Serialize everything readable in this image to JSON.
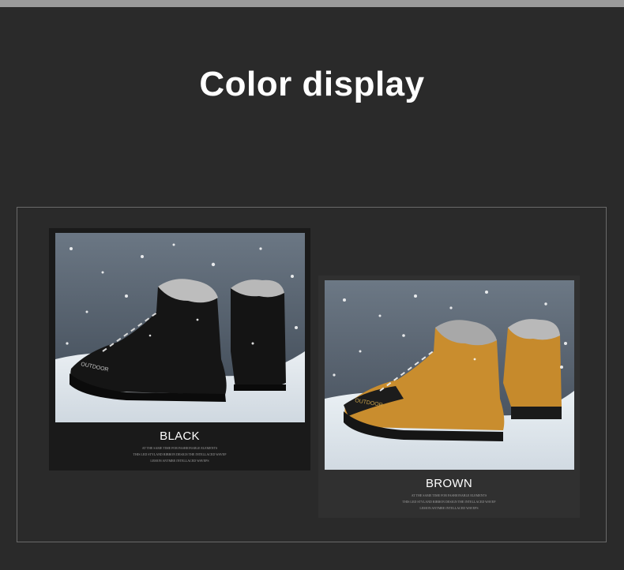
{
  "title": "Color display",
  "colors": {
    "background": "#2a2a2a",
    "black_card": "#1a1a1a",
    "brown_card": "#303030",
    "snow_sky": "#5a6673"
  },
  "variants": [
    {
      "label": "BLACK",
      "boot_color": "#151515",
      "boot_brand": "OUTDOOR",
      "caption_lines": [
        "AT THE SAME TIME FOR FASHIONABLE ELEMENTS",
        "THIS LED STYLAND RIBBON DESIGN THE INTELLACED WAVEP",
        "LEMON ANTMRE INTELLACED WAVEPS"
      ]
    },
    {
      "label": "BROWN",
      "boot_color": "#c68a2c",
      "boot_brand": "OUTDOOR",
      "caption_lines": [
        "AT THE SAME TIME FOR FASHIONABLE ELEMENTS",
        "THIS LED STYLAND RIBBON DESIGN THE INTELLACED WAVEP",
        "LEMON ANTMRE INTELLACED WAVEPS"
      ]
    }
  ]
}
